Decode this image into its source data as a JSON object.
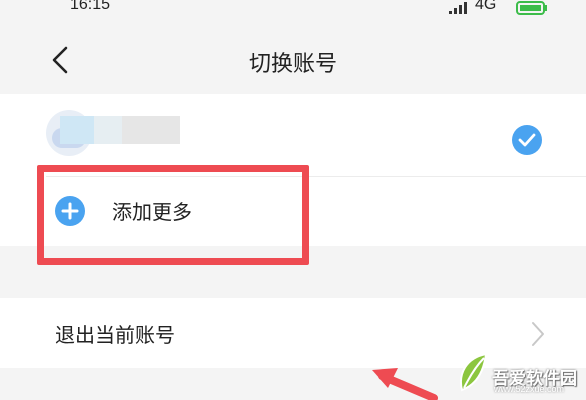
{
  "status_bar": {
    "time": "16:15",
    "network": "4G"
  },
  "header": {
    "title": "切换账号"
  },
  "accounts": {
    "current_selected": true
  },
  "add_more": {
    "label": "添加更多"
  },
  "logout": {
    "label": "退出当前账号"
  },
  "watermark": {
    "brand": "吾爱软件园",
    "url": "www.52zxue.com"
  },
  "colors": {
    "accent_blue": "#4aa3f0",
    "highlight_red": "#ee4b52"
  },
  "icons": [
    "signal-icon",
    "battery-icon",
    "back-arrow-icon",
    "avatar",
    "check-icon",
    "plus-icon",
    "chevron-right-icon",
    "arrow-icon"
  ]
}
